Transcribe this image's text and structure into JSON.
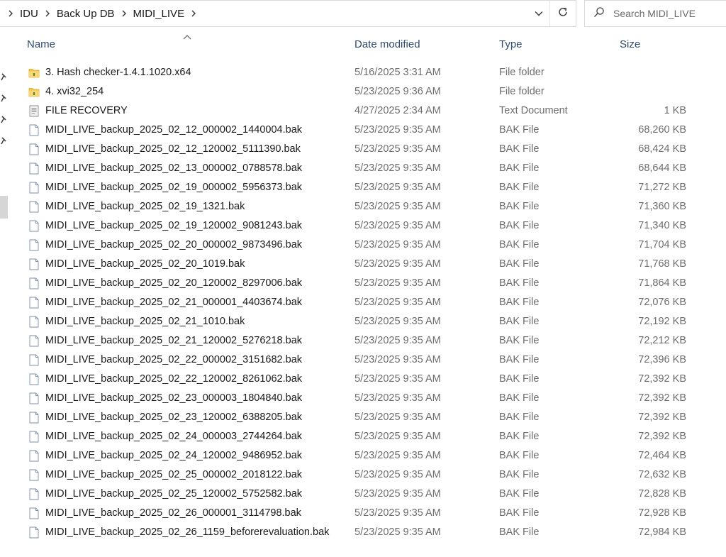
{
  "breadcrumb": {
    "items": [
      {
        "label": "IDU"
      },
      {
        "label": "Back Up DB"
      },
      {
        "label": "MIDI_LIVE"
      }
    ]
  },
  "search": {
    "placeholder": "Search MIDI_LIVE"
  },
  "columns": {
    "name": "Name",
    "date": "Date modified",
    "type": "Type",
    "size": "Size"
  },
  "sort": {
    "column": "Name",
    "direction": "ascending"
  },
  "files": [
    {
      "icon": "folder-icon",
      "name": "3. Hash checker-1.4.1.1020.x64",
      "date": "5/16/2025 3:31 AM",
      "type": "File folder",
      "size": ""
    },
    {
      "icon": "folder-icon",
      "name": "4. xvi32_254",
      "date": "5/23/2025 9:36 AM",
      "type": "File folder",
      "size": ""
    },
    {
      "icon": "text-doc-icon",
      "name": "FILE RECOVERY",
      "date": "4/27/2025 2:34 AM",
      "type": "Text Document",
      "size": "1 KB"
    },
    {
      "icon": "file-icon",
      "name": "MIDI_LIVE_backup_2025_02_12_000002_1440004.bak",
      "date": "5/23/2025 9:35 AM",
      "type": "BAK File",
      "size": "68,260 KB"
    },
    {
      "icon": "file-icon",
      "name": "MIDI_LIVE_backup_2025_02_12_120002_5111390.bak",
      "date": "5/23/2025 9:35 AM",
      "type": "BAK File",
      "size": "68,424 KB"
    },
    {
      "icon": "file-icon",
      "name": "MIDI_LIVE_backup_2025_02_13_000002_0788578.bak",
      "date": "5/23/2025 9:35 AM",
      "type": "BAK File",
      "size": "68,644 KB"
    },
    {
      "icon": "file-icon",
      "name": "MIDI_LIVE_backup_2025_02_19_000002_5956373.bak",
      "date": "5/23/2025 9:35 AM",
      "type": "BAK File",
      "size": "71,272 KB"
    },
    {
      "icon": "file-icon",
      "name": "MIDI_LIVE_backup_2025_02_19_1321.bak",
      "date": "5/23/2025 9:35 AM",
      "type": "BAK File",
      "size": "71,360 KB"
    },
    {
      "icon": "file-icon",
      "name": "MIDI_LIVE_backup_2025_02_19_120002_9081243.bak",
      "date": "5/23/2025 9:35 AM",
      "type": "BAK File",
      "size": "71,340 KB"
    },
    {
      "icon": "file-icon",
      "name": "MIDI_LIVE_backup_2025_02_20_000002_9873496.bak",
      "date": "5/23/2025 9:35 AM",
      "type": "BAK File",
      "size": "71,704 KB"
    },
    {
      "icon": "file-icon",
      "name": "MIDI_LIVE_backup_2025_02_20_1019.bak",
      "date": "5/23/2025 9:35 AM",
      "type": "BAK File",
      "size": "71,768 KB"
    },
    {
      "icon": "file-icon",
      "name": "MIDI_LIVE_backup_2025_02_20_120002_8297006.bak",
      "date": "5/23/2025 9:35 AM",
      "type": "BAK File",
      "size": "71,864 KB"
    },
    {
      "icon": "file-icon",
      "name": "MIDI_LIVE_backup_2025_02_21_000001_4403674.bak",
      "date": "5/23/2025 9:35 AM",
      "type": "BAK File",
      "size": "72,076 KB"
    },
    {
      "icon": "file-icon",
      "name": "MIDI_LIVE_backup_2025_02_21_1010.bak",
      "date": "5/23/2025 9:35 AM",
      "type": "BAK File",
      "size": "72,192 KB"
    },
    {
      "icon": "file-icon",
      "name": "MIDI_LIVE_backup_2025_02_21_120002_5276218.bak",
      "date": "5/23/2025 9:35 AM",
      "type": "BAK File",
      "size": "72,212 KB"
    },
    {
      "icon": "file-icon",
      "name": "MIDI_LIVE_backup_2025_02_22_000002_3151682.bak",
      "date": "5/23/2025 9:35 AM",
      "type": "BAK File",
      "size": "72,396 KB"
    },
    {
      "icon": "file-icon",
      "name": "MIDI_LIVE_backup_2025_02_22_120002_8261062.bak",
      "date": "5/23/2025 9:35 AM",
      "type": "BAK File",
      "size": "72,392 KB"
    },
    {
      "icon": "file-icon",
      "name": "MIDI_LIVE_backup_2025_02_23_000003_1804840.bak",
      "date": "5/23/2025 9:35 AM",
      "type": "BAK File",
      "size": "72,392 KB"
    },
    {
      "icon": "file-icon",
      "name": "MIDI_LIVE_backup_2025_02_23_120002_6388205.bak",
      "date": "5/23/2025 9:35 AM",
      "type": "BAK File",
      "size": "72,392 KB"
    },
    {
      "icon": "file-icon",
      "name": "MIDI_LIVE_backup_2025_02_24_000003_2744264.bak",
      "date": "5/23/2025 9:35 AM",
      "type": "BAK File",
      "size": "72,392 KB"
    },
    {
      "icon": "file-icon",
      "name": "MIDI_LIVE_backup_2025_02_24_120002_9486952.bak",
      "date": "5/23/2025 9:35 AM",
      "type": "BAK File",
      "size": "72,464 KB"
    },
    {
      "icon": "file-icon",
      "name": "MIDI_LIVE_backup_2025_02_25_000002_2018122.bak",
      "date": "5/23/2025 9:35 AM",
      "type": "BAK File",
      "size": "72,632 KB"
    },
    {
      "icon": "file-icon",
      "name": "MIDI_LIVE_backup_2025_02_25_120002_5752582.bak",
      "date": "5/23/2025 9:35 AM",
      "type": "BAK File",
      "size": "72,828 KB"
    },
    {
      "icon": "file-icon",
      "name": "MIDI_LIVE_backup_2025_02_26_000001_3114798.bak",
      "date": "5/23/2025 9:35 AM",
      "type": "BAK File",
      "size": "72,928 KB"
    },
    {
      "icon": "file-icon",
      "name": "MIDI_LIVE_backup_2025_02_26_1159_beforerevaluation.bak",
      "date": "5/23/2025 9:35 AM",
      "type": "BAK File",
      "size": "72,984 KB"
    }
  ],
  "colors": {
    "header_text": "#2e4a6e",
    "folder_yellow": "#f2c94c",
    "secondary_text": "#6d6d6d"
  }
}
